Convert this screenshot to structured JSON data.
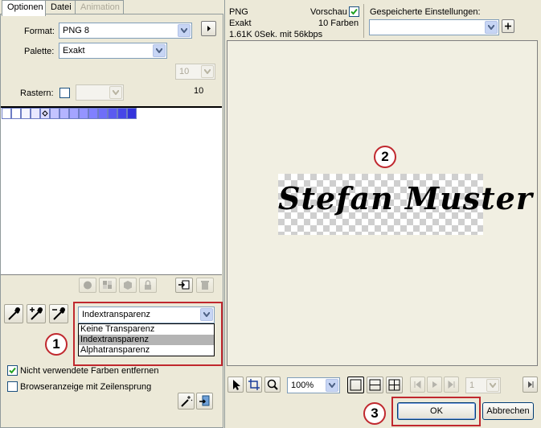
{
  "tabs": [
    {
      "label": "Optionen",
      "state": "active"
    },
    {
      "label": "Datei",
      "state": "normal"
    },
    {
      "label": "Animation",
      "state": "disabled"
    }
  ],
  "options": {
    "format_label": "Format:",
    "format_value": "PNG 8",
    "palette_label": "Palette:",
    "palette_value": "Exakt",
    "colors_select_value": "10",
    "colors_count": "10",
    "dither_label": "Rastern:",
    "dither_value": ""
  },
  "palette_swatches": [
    "#ffffff",
    "#ffffff",
    "#f4f4ff",
    "#e8e8ff",
    "#dcdcff",
    "#c4c4ff",
    "#b4b4ff",
    "#a4a4ff",
    "#9494ff",
    "#8080ff",
    "#6e6ef8",
    "#5a5af0",
    "#4747e8",
    "#3434dc"
  ],
  "transparency": {
    "selected": "Indextransparenz",
    "options": [
      "Keine Transparenz",
      "Indextransparenz",
      "Alphatransparenz"
    ],
    "highlighted_index": 1
  },
  "checkboxes": {
    "remove_unused_label": "Nicht verwendete Farben entfernen",
    "remove_unused_checked": true,
    "interlaced_label": "Browseranzeige mit Zeilensprung",
    "interlaced_checked": false
  },
  "preview_info": {
    "format": "PNG",
    "palette": "Exakt",
    "size_speed": "1.61K  0Sek. mit 56kbps",
    "preview_label": "Vorschau",
    "preview_checked": true,
    "color_count": "10 Farben"
  },
  "saved_settings": {
    "label": "Gespeicherte Einstellungen:",
    "value": ""
  },
  "preview_image": {
    "text": "Stefan Muster"
  },
  "bottom_toolbar": {
    "zoom_value": "100%",
    "frame_value": "1"
  },
  "buttons": {
    "ok": "OK",
    "cancel": "Abbrechen"
  },
  "callouts": [
    "1",
    "2",
    "3"
  ],
  "colors": {
    "annotation_red": "#c0282e",
    "highlight": "#b4b4b4",
    "swatch_blue": "#6d7cc4",
    "preview_bg": "#f1efe2"
  }
}
